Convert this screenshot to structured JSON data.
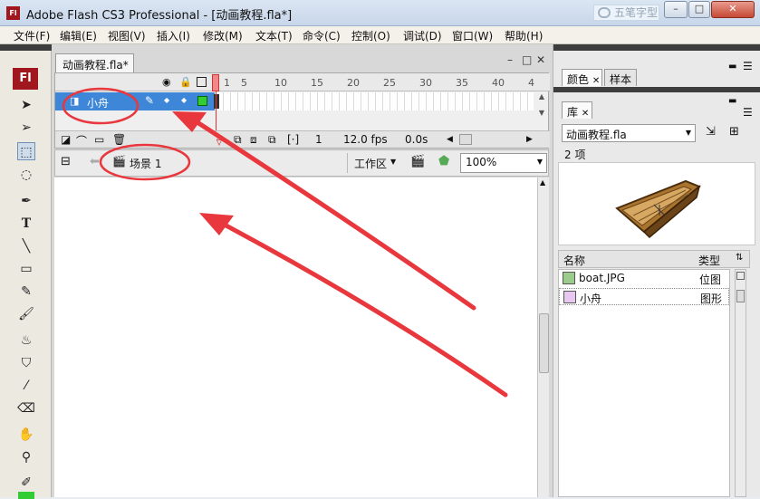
{
  "window": {
    "app_icon": "Fl",
    "title": "Adobe Flash CS3 Professional - [动画教程.fla*]",
    "watermark": "五笔字型",
    "buttons": {
      "minimize": "–",
      "maximize": "□",
      "close": "✕"
    }
  },
  "menubar": [
    "文件(F)",
    "编辑(E)",
    "视图(V)",
    "插入(I)",
    "修改(M)",
    "文本(T)",
    "命令(C)",
    "控制(O)",
    "调试(D)",
    "窗口(W)",
    "帮助(H)"
  ],
  "toolbox": {
    "logo": "Fl",
    "tools": [
      {
        "name": "selection",
        "icon": "arrow-icon",
        "glyph": "➤"
      },
      {
        "name": "subselection",
        "icon": "subselect-arrow-icon",
        "glyph": "➢"
      },
      {
        "name": "free-transform",
        "icon": "free-transform-icon",
        "glyph": "⬚"
      },
      {
        "name": "lasso",
        "icon": "lasso-icon",
        "glyph": "◌"
      },
      {
        "name": "pen",
        "icon": "pen-icon",
        "glyph": "✒"
      },
      {
        "name": "text",
        "icon": "text-icon",
        "glyph": "T"
      },
      {
        "name": "line",
        "icon": "line-icon",
        "glyph": "╲"
      },
      {
        "name": "rectangle",
        "icon": "rectangle-icon",
        "glyph": "▭"
      },
      {
        "name": "pencil",
        "icon": "pencil-icon",
        "glyph": "✎"
      },
      {
        "name": "brush",
        "icon": "brush-icon",
        "glyph": "🖌"
      },
      {
        "name": "ink-bottle",
        "icon": "ink-bottle-icon",
        "glyph": "♨"
      },
      {
        "name": "paint-bucket",
        "icon": "paint-bucket-icon",
        "glyph": "⛉"
      },
      {
        "name": "eyedropper",
        "icon": "eyedropper-icon",
        "glyph": "⁄"
      },
      {
        "name": "eraser",
        "icon": "eraser-icon",
        "glyph": "⌫"
      },
      {
        "name": "hand",
        "icon": "hand-icon",
        "glyph": "✋"
      },
      {
        "name": "zoom",
        "icon": "zoom-icon",
        "glyph": "⚲"
      },
      {
        "name": "stroke-color",
        "icon": "stroke-color-icon",
        "glyph": "✐"
      }
    ],
    "fill_color": "#33CC33"
  },
  "document": {
    "tab_label": "动画教程.fla*",
    "tab_controls": {
      "minimize": "–",
      "restore": "□",
      "close": "✕"
    },
    "timeline": {
      "ruler_numbers": [
        "1",
        "5",
        "10",
        "15",
        "20",
        "25",
        "30",
        "35",
        "40",
        "4"
      ],
      "layer": {
        "name": "小舟",
        "marker": "◆"
      },
      "status": {
        "current_frame": "1",
        "frame_rate": "12.0 fps",
        "elapsed_time": "0.0s"
      }
    },
    "edit_bar": {
      "scene": "场景 1",
      "workspace": "工作区",
      "zoom": "100%"
    }
  },
  "right_panel": {
    "top_tabs": [
      "颜色",
      "样本"
    ],
    "library": {
      "tab": "库",
      "document_name": "动画教程.fla",
      "item_count": "2 项",
      "columns": {
        "name": "名称",
        "type": "类型"
      },
      "items": [
        {
          "name": "boat.JPG",
          "type": "位图"
        },
        {
          "name": "小舟",
          "type": "图形"
        }
      ]
    }
  },
  "colors": {
    "annotation": "#E8383D",
    "layer_highlight": "#3D86D8",
    "flash_red": "#A0171E"
  }
}
